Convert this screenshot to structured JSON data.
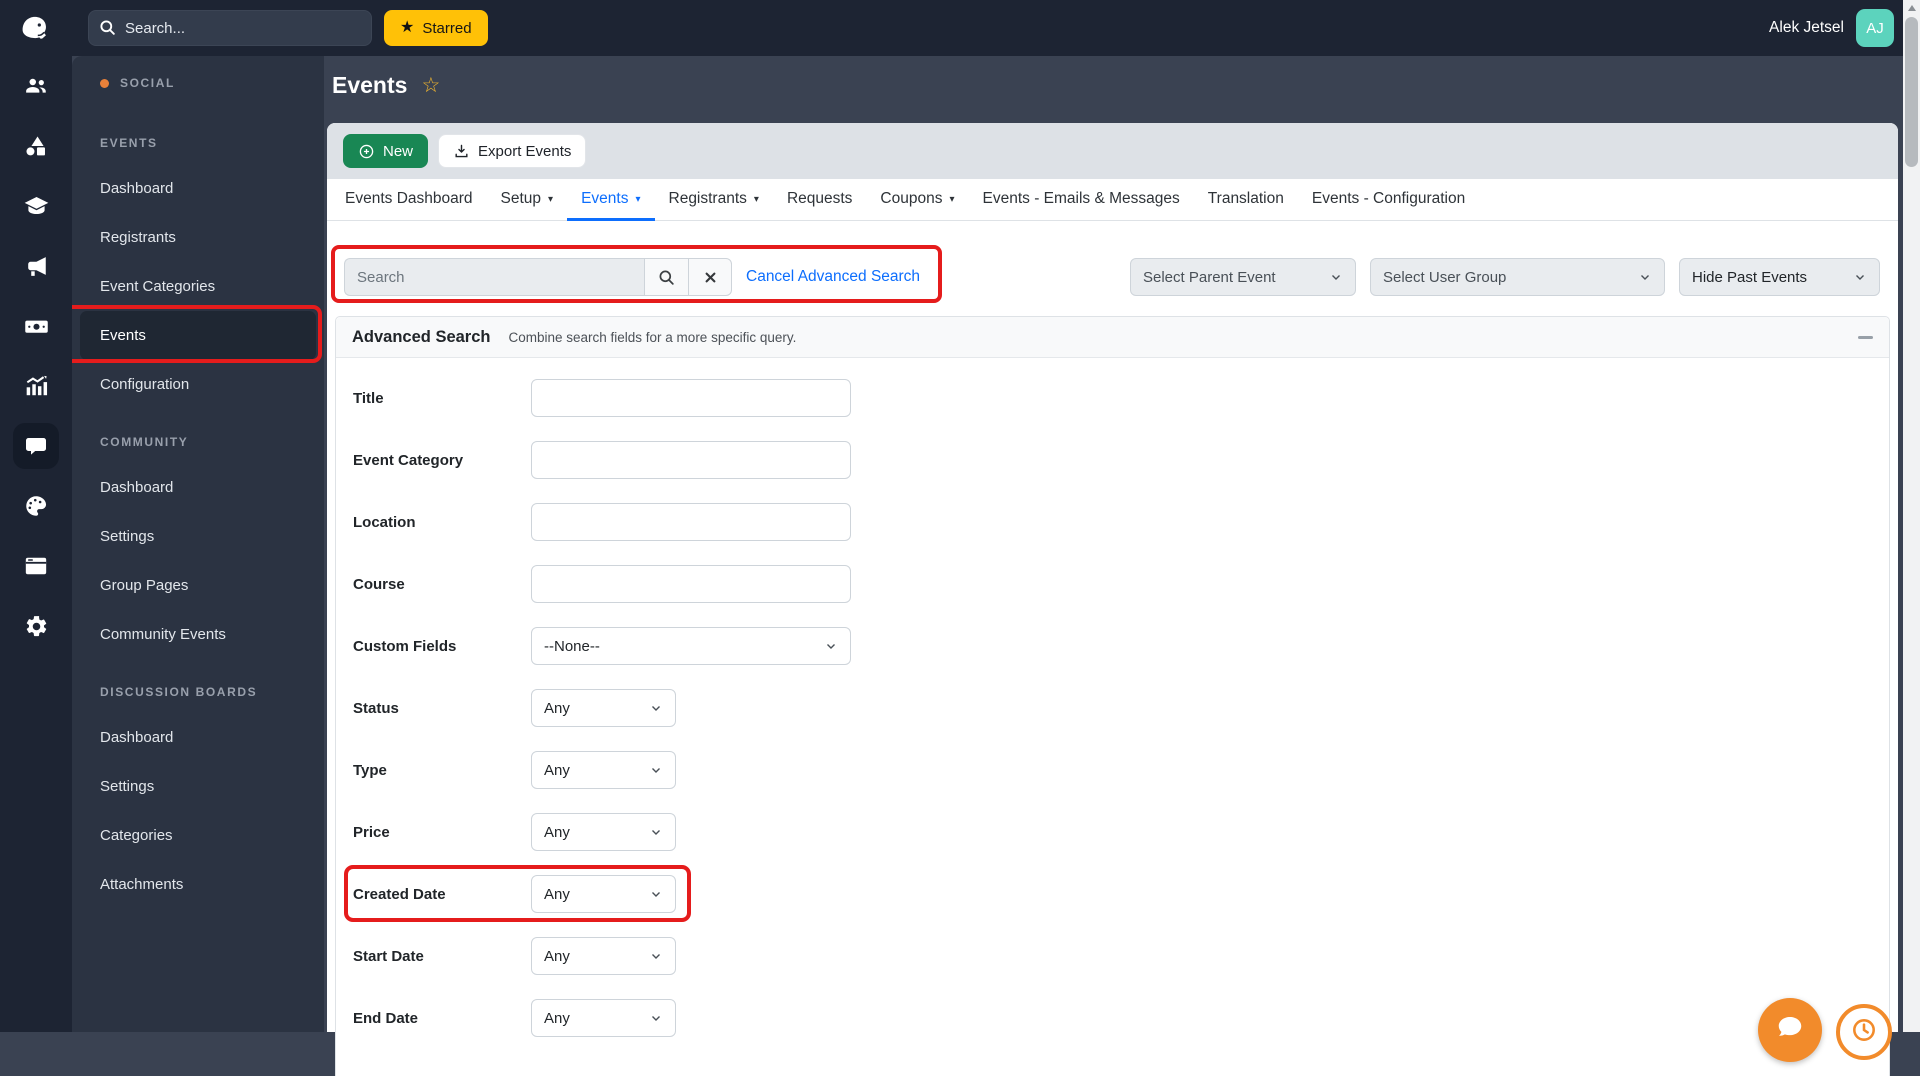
{
  "topbar": {
    "search_placeholder": "Search...",
    "starred_label": "Starred",
    "user_name": "Alek Jetsel",
    "avatar_initials": "AJ"
  },
  "rail": {
    "icons": [
      "users",
      "shapes",
      "graduation-cap",
      "megaphone",
      "money",
      "bar-chart",
      "chat",
      "palette",
      "window",
      "gear"
    ],
    "active_icon": "chat"
  },
  "sidebar": {
    "product_label": "SOCIAL",
    "sections": [
      {
        "header": "EVENTS",
        "items": [
          {
            "label": "Dashboard"
          },
          {
            "label": "Registrants"
          },
          {
            "label": "Event Categories"
          },
          {
            "label": "Events",
            "active": true
          },
          {
            "label": "Configuration"
          }
        ]
      },
      {
        "header": "COMMUNITY",
        "items": [
          {
            "label": "Dashboard"
          },
          {
            "label": "Settings"
          },
          {
            "label": "Group Pages"
          },
          {
            "label": "Community Events"
          }
        ]
      },
      {
        "header": "DISCUSSION BOARDS",
        "items": [
          {
            "label": "Dashboard"
          },
          {
            "label": "Settings"
          },
          {
            "label": "Categories"
          },
          {
            "label": "Attachments"
          }
        ]
      }
    ]
  },
  "page": {
    "title": "Events"
  },
  "toolbar": {
    "new_label": "New",
    "export_label": "Export Events"
  },
  "tabs": [
    {
      "label": "Events Dashboard",
      "caret": false,
      "active": false
    },
    {
      "label": "Setup",
      "caret": true,
      "active": false
    },
    {
      "label": "Events",
      "caret": true,
      "active": true
    },
    {
      "label": "Registrants",
      "caret": true,
      "active": false
    },
    {
      "label": "Requests",
      "caret": false,
      "active": false
    },
    {
      "label": "Coupons",
      "caret": true,
      "active": false
    },
    {
      "label": "Events - Emails & Messages",
      "caret": false,
      "active": false
    },
    {
      "label": "Translation",
      "caret": false,
      "active": false
    },
    {
      "label": "Events - Configuration",
      "caret": false,
      "active": false
    }
  ],
  "filters": {
    "search_placeholder": "Search",
    "cancel_link": "Cancel Advanced Search",
    "parent_event_select": "Select Parent Event",
    "user_group_select": "Select User Group",
    "past_events_select": "Hide Past Events"
  },
  "advanced_search": {
    "title": "Advanced Search",
    "subtitle": "Combine search fields for a more specific query.",
    "fields": [
      {
        "label": "Title",
        "type": "text",
        "value": ""
      },
      {
        "label": "Event Category",
        "type": "text",
        "value": ""
      },
      {
        "label": "Location",
        "type": "text",
        "value": ""
      },
      {
        "label": "Course",
        "type": "text",
        "value": ""
      },
      {
        "label": "Custom Fields",
        "type": "select",
        "value": "--None--",
        "wide": true
      },
      {
        "label": "Status",
        "type": "select",
        "value": "Any"
      },
      {
        "label": "Type",
        "type": "select",
        "value": "Any"
      },
      {
        "label": "Price",
        "type": "select",
        "value": "Any"
      },
      {
        "label": "Created Date",
        "type": "select",
        "value": "Any",
        "annotated": true
      },
      {
        "label": "Start Date",
        "type": "select",
        "value": "Any"
      },
      {
        "label": "End Date",
        "type": "select",
        "value": "Any"
      }
    ]
  },
  "annotations": {
    "color": "#e51c1c",
    "boxes": [
      "sidebar-events-item",
      "search-and-cancel-advanced-search",
      "created-date-row"
    ]
  },
  "colors": {
    "topbar_bg": "#1d2433",
    "sidebar_bg": "#2b3342",
    "main_bg": "#3a4252",
    "accent_blue": "#0d6efd",
    "new_green": "#198754",
    "starred_yellow": "#ffc107",
    "avatar_teal": "#5cd3bd",
    "fab_orange": "#f28b2b",
    "social_dot": "#e8813a"
  }
}
